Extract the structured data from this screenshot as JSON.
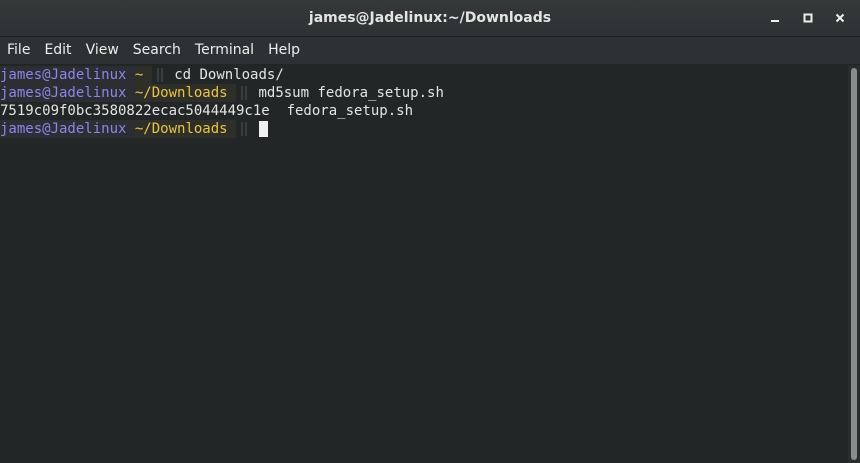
{
  "window": {
    "title": "james@Jadelinux:~/Downloads"
  },
  "window_controls": {
    "minimize_icon": "minimize-icon",
    "maximize_icon": "maximize-icon",
    "close_icon": "close-icon"
  },
  "menu": {
    "items": [
      {
        "label": "File"
      },
      {
        "label": "Edit"
      },
      {
        "label": "View"
      },
      {
        "label": "Search"
      },
      {
        "label": "Terminal"
      },
      {
        "label": "Help"
      }
    ]
  },
  "terminal": {
    "lines": [
      {
        "user": "james@Jadelinux",
        "dir": "~",
        "command": "cd Downloads/"
      },
      {
        "user": "james@Jadelinux",
        "dir": "~/Downloads",
        "command": "md5sum fedora_setup.sh"
      },
      {
        "output": "7519c09f0bc3580822ecac5044449c1e  fedora_setup.sh"
      },
      {
        "user": "james@Jadelinux",
        "dir": "~/Downloads",
        "command": ""
      }
    ]
  },
  "colors": {
    "user": "#8a87e8",
    "dir": "#e8c44a",
    "background": "#222627",
    "text": "#e4e4e4"
  }
}
